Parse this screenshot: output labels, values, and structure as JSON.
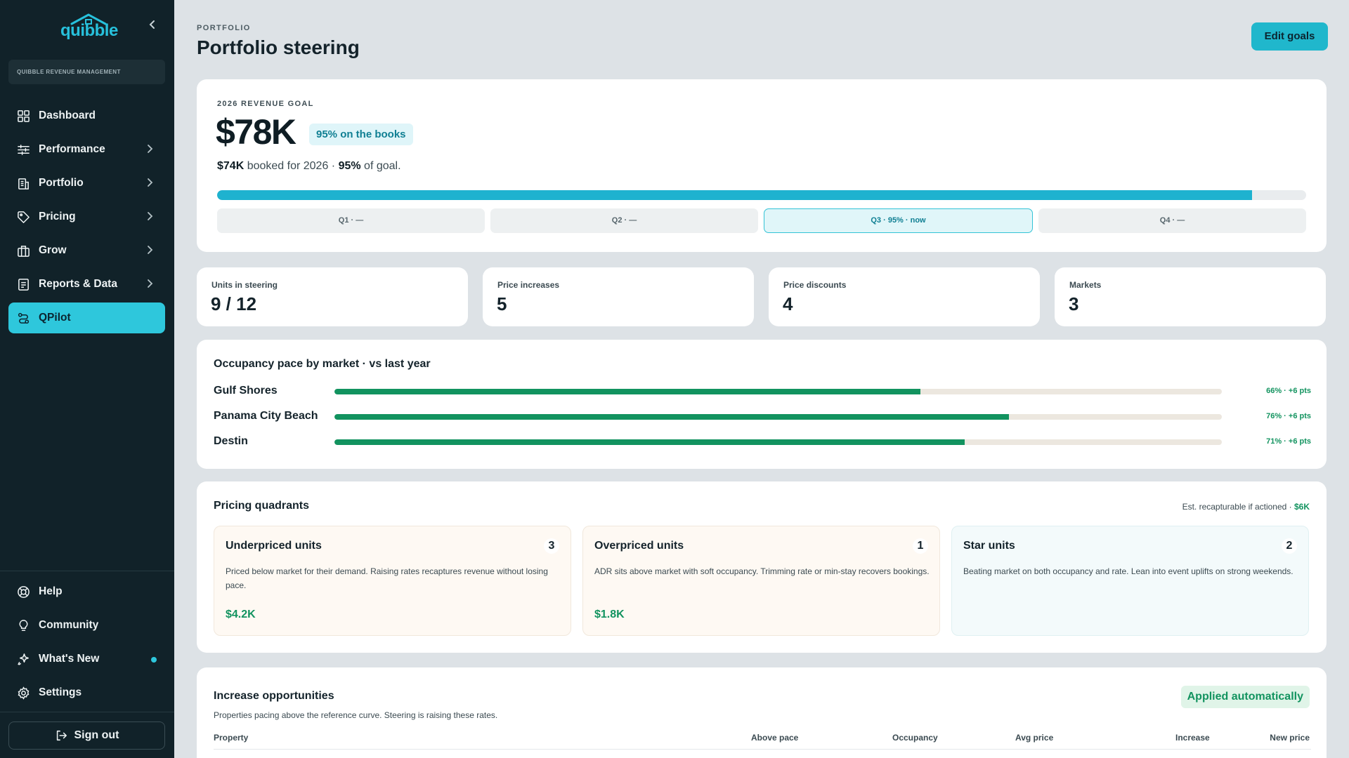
{
  "sidebar": {
    "logo_text": "quibble",
    "org_label": "QUIBBLE REVENUE MANAGEMENT",
    "nav": [
      {
        "label": "Dashboard",
        "icon": "grid-icon",
        "chevron": false,
        "active": false
      },
      {
        "label": "Performance",
        "icon": "sliders-icon",
        "chevron": true,
        "active": false
      },
      {
        "label": "Portfolio",
        "icon": "building-icon",
        "chevron": true,
        "active": false
      },
      {
        "label": "Pricing",
        "icon": "tag-icon",
        "chevron": true,
        "active": false
      },
      {
        "label": "Grow",
        "icon": "briefcase-icon",
        "chevron": true,
        "active": false
      },
      {
        "label": "Reports & Data",
        "icon": "report-icon",
        "chevron": true,
        "active": false
      },
      {
        "label": "QPilot",
        "icon": "route-icon",
        "chevron": false,
        "active": true
      }
    ],
    "bottom_nav": [
      {
        "label": "Help",
        "icon": "lifebuoy-icon"
      },
      {
        "label": "Community",
        "icon": "lightbulb-icon"
      },
      {
        "label": "What's New",
        "icon": "sparkle-icon",
        "dot": true
      },
      {
        "label": "Settings",
        "icon": "gear-icon"
      }
    ],
    "sign_out": "Sign out"
  },
  "header": {
    "eyebrow": "PORTFOLIO",
    "title": "Portfolio steering",
    "edit_button": "Edit goals"
  },
  "goal": {
    "eyebrow": "2026 REVENUE GOAL",
    "value": "$78K",
    "badge": "95% on the books",
    "booked_amount": "$74K",
    "booked_text": " booked for 2026 · ",
    "percent": "95%",
    "percent_suffix": " of goal.",
    "progress_fraction": 0.95,
    "quarters": [
      {
        "label": "Q1 · —",
        "current": false
      },
      {
        "label": "Q2 · —",
        "current": false
      },
      {
        "label": "Q3 · 95% · now",
        "current": true
      },
      {
        "label": "Q4 · —",
        "current": false
      }
    ]
  },
  "stats": [
    {
      "label": "Units in steering",
      "value": "9 / 12"
    },
    {
      "label": "Price increases",
      "value": "5"
    },
    {
      "label": "Price discounts",
      "value": "4"
    },
    {
      "label": "Markets",
      "value": "3"
    }
  ],
  "occupancy": {
    "title": "Occupancy pace by market · vs last year",
    "markets": [
      {
        "name": "Gulf Shores",
        "pace": 0.66,
        "label": "66% · +6 pts"
      },
      {
        "name": "Panama City Beach",
        "pace": 0.76,
        "label": "76% · +6 pts"
      },
      {
        "name": "Destin",
        "pace": 0.71,
        "label": "71% · +6 pts"
      }
    ]
  },
  "quadrants": {
    "title": "Pricing quadrants",
    "note": "Est. recapturable if actioned · ",
    "note_value": "$6K",
    "cards": [
      {
        "title": "Underpriced units",
        "count": "3",
        "desc": "Priced below market for their demand. Raising rates recaptures revenue without losing pace.",
        "value": "$4.2K",
        "variant": "warm"
      },
      {
        "title": "Overpriced units",
        "count": "1",
        "desc": "ADR sits above market with soft occupancy. Trimming rate or min-stay recovers bookings.",
        "value": "$1.8K",
        "variant": "warm"
      },
      {
        "title": "Star units",
        "count": "2",
        "desc": "Beating market on both occupancy and rate. Lean into event uplifts on strong weekends.",
        "value": "",
        "variant": "star"
      }
    ]
  },
  "increase": {
    "title": "Increase opportunities",
    "badge": "Applied automatically",
    "subtitle": "Properties pacing above the reference curve. Steering is raising these rates.",
    "columns": [
      "Property",
      "Above pace",
      "Occupancy",
      "Avg price",
      "Increase",
      "New price"
    ]
  },
  "colors": {
    "accent": "#2ec7dc",
    "sidebar_bg": "#112229",
    "success": "#12935f",
    "goal_bar": "#1eb2cf"
  }
}
